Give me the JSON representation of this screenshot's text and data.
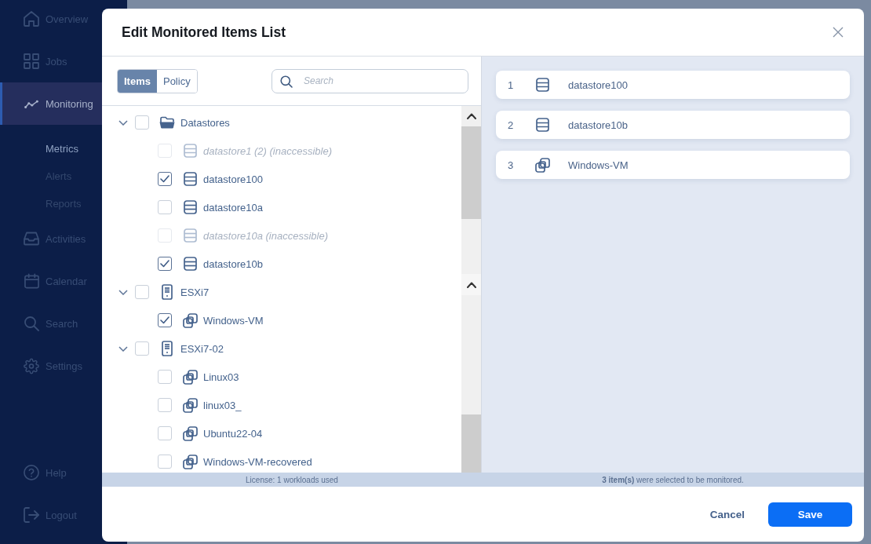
{
  "sidebar": {
    "items": [
      {
        "label": "Overview",
        "selected": false
      },
      {
        "label": "Jobs",
        "selected": false
      },
      {
        "label": "Monitoring",
        "selected": true,
        "children": [
          {
            "label": "Metrics",
            "selected": true
          },
          {
            "label": "Alerts",
            "selected": false
          },
          {
            "label": "Reports",
            "selected": false
          }
        ]
      },
      {
        "label": "Activities",
        "selected": false
      },
      {
        "label": "Calendar",
        "selected": false
      },
      {
        "label": "Search",
        "selected": false
      },
      {
        "label": "Settings",
        "selected": false
      }
    ],
    "bottom_items": [
      {
        "label": "Help",
        "selected": false
      },
      {
        "label": "Logout",
        "selected": false
      }
    ]
  },
  "dialog": {
    "title": "Edit Monitored Items List",
    "view_tabs": [
      {
        "label": "Items",
        "selected": true
      },
      {
        "label": "Policy",
        "selected": false
      }
    ],
    "search": {
      "placeholder": "Search"
    },
    "tree": [
      {
        "label": "Datastores",
        "kind": "folder",
        "expanded": true,
        "checked": false,
        "disabled": false,
        "children": [
          {
            "label": "datastore1 (2) (inaccessible)",
            "kind": "datastore",
            "checked": false,
            "disabled": true
          },
          {
            "label": "datastore100",
            "kind": "datastore",
            "checked": true,
            "disabled": false
          },
          {
            "label": "datastore10a",
            "kind": "datastore",
            "checked": false,
            "disabled": false
          },
          {
            "label": "datastore10a (inaccessible)",
            "kind": "datastore",
            "checked": false,
            "disabled": true
          },
          {
            "label": "datastore10b",
            "kind": "datastore",
            "checked": true,
            "disabled": false
          }
        ]
      },
      {
        "label": "ESXi7",
        "kind": "host",
        "expanded": true,
        "checked": false,
        "disabled": false,
        "children": [
          {
            "label": "Windows-VM",
            "kind": "vm",
            "checked": true,
            "disabled": false
          }
        ]
      },
      {
        "label": "ESXi7-02",
        "kind": "host",
        "expanded": true,
        "checked": false,
        "disabled": false,
        "children": [
          {
            "label": "Linux03",
            "kind": "vm",
            "checked": false,
            "disabled": false
          },
          {
            "label": "linux03_",
            "kind": "vm",
            "checked": false,
            "disabled": false
          },
          {
            "label": "Ubuntu22-04",
            "kind": "vm",
            "checked": false,
            "disabled": false
          },
          {
            "label": "Windows-VM-recovered",
            "kind": "vm",
            "checked": false,
            "disabled": false
          }
        ]
      }
    ],
    "selected_items": [
      {
        "number": "1",
        "label": "datastore100",
        "kind": "datastore"
      },
      {
        "number": "2",
        "label": "datastore10b",
        "kind": "datastore"
      },
      {
        "number": "3",
        "label": "Windows-VM",
        "kind": "vm"
      }
    ],
    "status_bar": {
      "license": "License: 1 workloads used",
      "selection": "**3 item(s)** were selected to be monitored."
    },
    "buttons": [
      {
        "label": "Cancel",
        "kind": "secondary"
      },
      {
        "label": "Save",
        "kind": "primary"
      }
    ]
  }
}
